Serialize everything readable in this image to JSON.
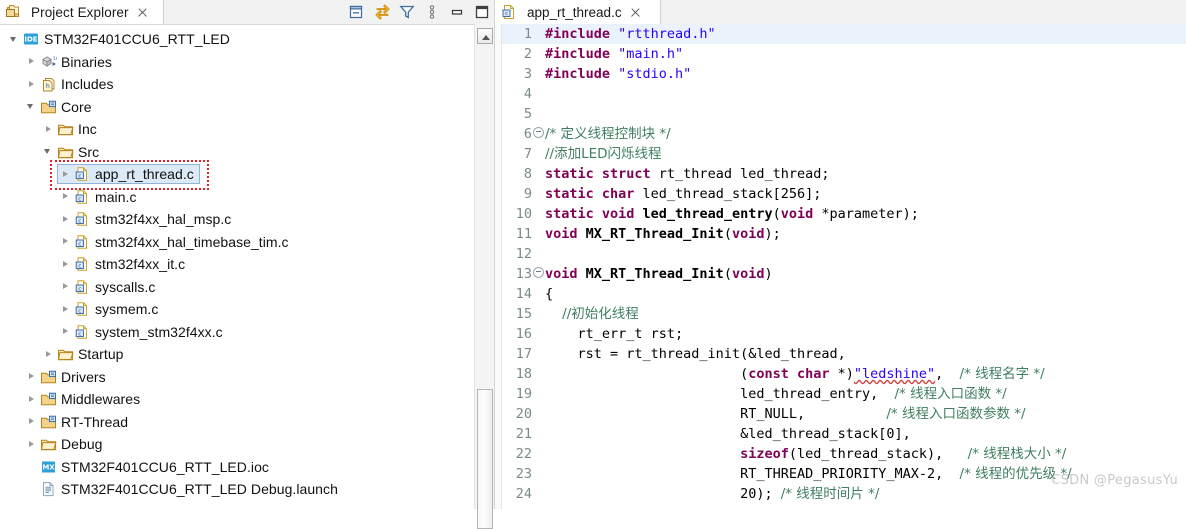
{
  "colors": {
    "accent": "#dceaf7",
    "annotation": "#ec1c24",
    "keyword": "#7f0055",
    "string": "#2a00ff",
    "comment": "#3f7f5f",
    "line_highlight": "#eaf2fb"
  },
  "explorer": {
    "tab_label": "Project Explorer",
    "tab_icon": "project-explorer-icon",
    "close_icon": "close-icon",
    "toolbar": [
      {
        "name": "collapse-all-icon",
        "title": "Collapse All"
      },
      {
        "name": "link-with-editor-icon",
        "title": "Link with Editor"
      },
      {
        "name": "filter-icon",
        "title": "Filters"
      },
      {
        "name": "view-menu-icon",
        "title": "View Menu"
      },
      {
        "name": "minimize-icon",
        "title": "Minimize"
      },
      {
        "name": "maximize-icon",
        "title": "Maximize"
      }
    ],
    "tree": [
      {
        "label": "STM32F401CCU6_RTT_LED",
        "depth": 0,
        "arrow": "open",
        "icon": "ide-project-icon",
        "selected": false
      },
      {
        "label": "Binaries",
        "depth": 1,
        "arrow": "closed",
        "icon": "binaries-icon",
        "selected": false
      },
      {
        "label": "Includes",
        "depth": 1,
        "arrow": "closed",
        "icon": "includes-icon",
        "selected": false
      },
      {
        "label": "Core",
        "depth": 1,
        "arrow": "open",
        "icon": "source-folder-icon",
        "selected": false
      },
      {
        "label": "Inc",
        "depth": 2,
        "arrow": "closed",
        "icon": "folder-icon",
        "selected": false
      },
      {
        "label": "Src",
        "depth": 2,
        "arrow": "open",
        "icon": "folder-icon",
        "selected": false
      },
      {
        "label": "app_rt_thread.c",
        "depth": 3,
        "arrow": "closed",
        "icon": "c-file-icon",
        "selected": true
      },
      {
        "label": "main.c",
        "depth": 3,
        "arrow": "closed",
        "icon": "c-file-icon",
        "selected": false
      },
      {
        "label": "stm32f4xx_hal_msp.c",
        "depth": 3,
        "arrow": "closed",
        "icon": "c-file-icon",
        "selected": false
      },
      {
        "label": "stm32f4xx_hal_timebase_tim.c",
        "depth": 3,
        "arrow": "closed",
        "icon": "c-file-icon",
        "selected": false
      },
      {
        "label": "stm32f4xx_it.c",
        "depth": 3,
        "arrow": "closed",
        "icon": "c-file-icon",
        "selected": false
      },
      {
        "label": "syscalls.c",
        "depth": 3,
        "arrow": "closed",
        "icon": "c-file-icon",
        "selected": false
      },
      {
        "label": "sysmem.c",
        "depth": 3,
        "arrow": "closed",
        "icon": "c-file-icon",
        "selected": false
      },
      {
        "label": "system_stm32f4xx.c",
        "depth": 3,
        "arrow": "closed",
        "icon": "c-file-icon",
        "selected": false
      },
      {
        "label": "Startup",
        "depth": 2,
        "arrow": "closed",
        "icon": "folder-icon",
        "selected": false
      },
      {
        "label": "Drivers",
        "depth": 1,
        "arrow": "closed",
        "icon": "source-folder-icon",
        "selected": false
      },
      {
        "label": "Middlewares",
        "depth": 1,
        "arrow": "closed",
        "icon": "source-folder-icon",
        "selected": false
      },
      {
        "label": "RT-Thread",
        "depth": 1,
        "arrow": "closed",
        "icon": "source-folder-icon",
        "selected": false
      },
      {
        "label": "Debug",
        "depth": 1,
        "arrow": "closed",
        "icon": "folder-icon",
        "selected": false
      },
      {
        "label": "STM32F401CCU6_RTT_LED.ioc",
        "depth": 1,
        "arrow": "none",
        "icon": "cubemx-icon",
        "selected": false
      },
      {
        "label": "STM32F401CCU6_RTT_LED Debug.launch",
        "depth": 1,
        "arrow": "none",
        "icon": "launch-file-icon",
        "selected": false
      }
    ],
    "scrollbar": {
      "up_arrow_icon": "scroll-up-icon"
    }
  },
  "editor": {
    "tab_label": "app_rt_thread.c",
    "tab_icon": "c-file-icon",
    "close_icon": "close-icon",
    "lines": [
      {
        "n": "1",
        "fold": false,
        "hl": true,
        "parts": [
          {
            "t": "#include ",
            "c": "pp"
          },
          {
            "t": "\"rtthread.h\"",
            "c": "str"
          }
        ]
      },
      {
        "n": "2",
        "fold": false,
        "hl": false,
        "parts": [
          {
            "t": "#include ",
            "c": "pp"
          },
          {
            "t": "\"main.h\"",
            "c": "str"
          }
        ]
      },
      {
        "n": "3",
        "fold": false,
        "hl": false,
        "parts": [
          {
            "t": "#include ",
            "c": "pp"
          },
          {
            "t": "\"stdio.h\"",
            "c": "str"
          }
        ]
      },
      {
        "n": "4",
        "fold": false,
        "hl": false,
        "parts": []
      },
      {
        "n": "5",
        "fold": false,
        "hl": false,
        "parts": []
      },
      {
        "n": "6",
        "fold": true,
        "hl": false,
        "parts": [
          {
            "t": "/* 定义线程控制块 */",
            "c": "cmt zh"
          }
        ]
      },
      {
        "n": "7",
        "fold": false,
        "hl": false,
        "parts": [
          {
            "t": "//添加LED闪烁线程",
            "c": "cmt zh"
          }
        ]
      },
      {
        "n": "8",
        "fold": false,
        "hl": false,
        "parts": [
          {
            "t": "static struct ",
            "c": "kw"
          },
          {
            "t": "rt_thread led_thread;",
            "c": "pl"
          }
        ]
      },
      {
        "n": "9",
        "fold": false,
        "hl": false,
        "parts": [
          {
            "t": "static char ",
            "c": "kw"
          },
          {
            "t": "led_thread_stack[256];",
            "c": "pl"
          }
        ]
      },
      {
        "n": "10",
        "fold": false,
        "hl": false,
        "parts": [
          {
            "t": "static void ",
            "c": "kw"
          },
          {
            "t": "led_thread_entry",
            "c": "fn"
          },
          {
            "t": "(",
            "c": "pl"
          },
          {
            "t": "void",
            "c": "kw"
          },
          {
            "t": " *parameter);",
            "c": "pl"
          }
        ]
      },
      {
        "n": "11",
        "fold": false,
        "hl": false,
        "parts": [
          {
            "t": "void ",
            "c": "kw"
          },
          {
            "t": "MX_RT_Thread_Init",
            "c": "fn"
          },
          {
            "t": "(",
            "c": "pl"
          },
          {
            "t": "void",
            "c": "kw"
          },
          {
            "t": ");",
            "c": "pl"
          }
        ]
      },
      {
        "n": "12",
        "fold": false,
        "hl": false,
        "parts": []
      },
      {
        "n": "13",
        "fold": true,
        "hl": false,
        "parts": [
          {
            "t": "void ",
            "c": "kw"
          },
          {
            "t": "MX_RT_Thread_Init",
            "c": "fn"
          },
          {
            "t": "(",
            "c": "pl"
          },
          {
            "t": "void",
            "c": "kw"
          },
          {
            "t": ")",
            "c": "pl"
          }
        ]
      },
      {
        "n": "14",
        "fold": false,
        "hl": false,
        "parts": [
          {
            "t": "{",
            "c": "pl"
          }
        ]
      },
      {
        "n": "15",
        "fold": false,
        "hl": false,
        "parts": [
          {
            "t": "    //初始化线程",
            "c": "cmt zh"
          }
        ]
      },
      {
        "n": "16",
        "fold": false,
        "hl": false,
        "parts": [
          {
            "t": "    rt_err_t rst;",
            "c": "pl"
          }
        ]
      },
      {
        "n": "17",
        "fold": false,
        "hl": false,
        "parts": [
          {
            "t": "    rst = rt_thread_init(&led_thread,",
            "c": "pl"
          }
        ]
      },
      {
        "n": "18",
        "fold": false,
        "hl": false,
        "parts": [
          {
            "t": "                        (",
            "c": "pl"
          },
          {
            "t": "const char ",
            "c": "kw"
          },
          {
            "t": "*)",
            "c": "pl"
          },
          {
            "t": "\"ledshine\"",
            "c": "str spell"
          },
          {
            "t": ",  ",
            "c": "pl"
          },
          {
            "t": "/* 线程名字 */",
            "c": "cmt zh"
          }
        ]
      },
      {
        "n": "19",
        "fold": false,
        "hl": false,
        "parts": [
          {
            "t": "                        led_thread_entry,  ",
            "c": "pl"
          },
          {
            "t": "/* 线程入口函数 */",
            "c": "cmt zh"
          }
        ]
      },
      {
        "n": "20",
        "fold": false,
        "hl": false,
        "parts": [
          {
            "t": "                        RT_NULL,          ",
            "c": "pl"
          },
          {
            "t": "/* 线程入口函数参数 */",
            "c": "cmt zh"
          }
        ]
      },
      {
        "n": "21",
        "fold": false,
        "hl": false,
        "parts": [
          {
            "t": "                        &led_thread_stack[0],",
            "c": "pl"
          }
        ]
      },
      {
        "n": "22",
        "fold": false,
        "hl": false,
        "parts": [
          {
            "t": "                        ",
            "c": "pl"
          },
          {
            "t": "sizeof",
            "c": "kw"
          },
          {
            "t": "(led_thread_stack),   ",
            "c": "pl"
          },
          {
            "t": "/* 线程栈大小 */",
            "c": "cmt zh"
          }
        ]
      },
      {
        "n": "23",
        "fold": false,
        "hl": false,
        "parts": [
          {
            "t": "                        RT_THREAD_PRIORITY_MAX-2,  ",
            "c": "pl"
          },
          {
            "t": "/* 线程的优先级 */",
            "c": "cmt zh"
          }
        ]
      },
      {
        "n": "24",
        "fold": false,
        "hl": false,
        "parts": [
          {
            "t": "                        20); ",
            "c": "pl"
          },
          {
            "t": "/* 线程时间片 */",
            "c": "cmt zh"
          }
        ]
      }
    ],
    "watermark": "CSDN @PegasusYu"
  }
}
